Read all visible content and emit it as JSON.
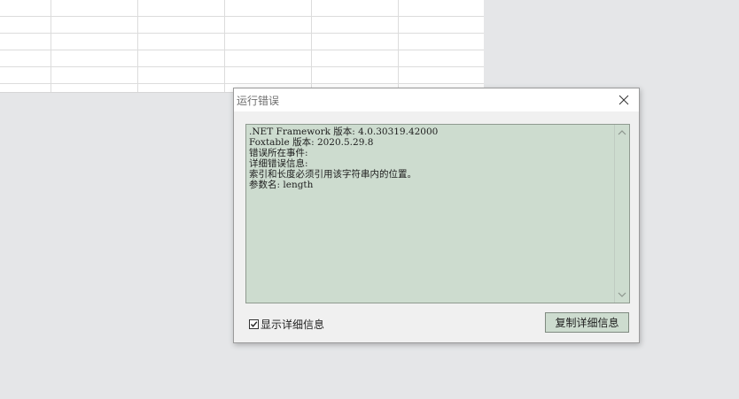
{
  "dialog": {
    "title": "运行错误",
    "close_icon": "close-icon",
    "details": {
      "lines": [
        ".NET Framework 版本: 4.0.30319.42000",
        "Foxtable 版本: 2020.5.29.8",
        "错误所在事件:",
        "详细错误信息:",
        "索引和长度必须引用该字符串内的位置。",
        "参数名: length"
      ]
    },
    "show_details_checkbox": {
      "label": "显示详细信息",
      "checked": true
    },
    "copy_button_label": "复制详细信息"
  },
  "colors": {
    "detail_background": "#cddccf",
    "window_background": "#f0f0f0",
    "desktop_background": "#e5e6e8"
  }
}
